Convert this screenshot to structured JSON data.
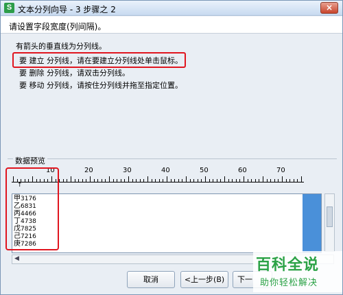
{
  "window": {
    "icon_label": "S",
    "title": "文本分列向导 - 3 步骤之 2",
    "close_label": "×"
  },
  "instruction": "请设置字段宽度(列间隔)。",
  "info": {
    "line1": "有箭头的垂直线为分列线。",
    "line2": "要 建立 分列线，请在要建立分列线处单击鼠标。",
    "line3": "要 删除 分列线，请双击分列线。",
    "line4": "要 移动 分列线，请按住分列线并拖至指定位置。"
  },
  "preview": {
    "label": "数据预览",
    "ruler": [
      "10",
      "20",
      "30",
      "40",
      "50",
      "60",
      "70"
    ],
    "marker": "↑",
    "rows": [
      {
        "name": "甲",
        "value": "3176"
      },
      {
        "name": "乙",
        "value": "6831"
      },
      {
        "name": "丙",
        "value": "4466"
      },
      {
        "name": "丁",
        "value": "4738"
      },
      {
        "name": "戊",
        "value": "7825"
      },
      {
        "name": "己",
        "value": "7216"
      },
      {
        "name": "庚",
        "value": "7286"
      }
    ],
    "hscroll_arrow": "◀"
  },
  "buttons": {
    "cancel": "取消",
    "back": "<上一步(B)",
    "next": "下一"
  },
  "watermark": {
    "title": "百科全说",
    "subtitle": "助你轻松解决"
  },
  "colors": {
    "accent": "#2ba246",
    "highlight": "#e0141e",
    "selection": "#4a90d9"
  }
}
